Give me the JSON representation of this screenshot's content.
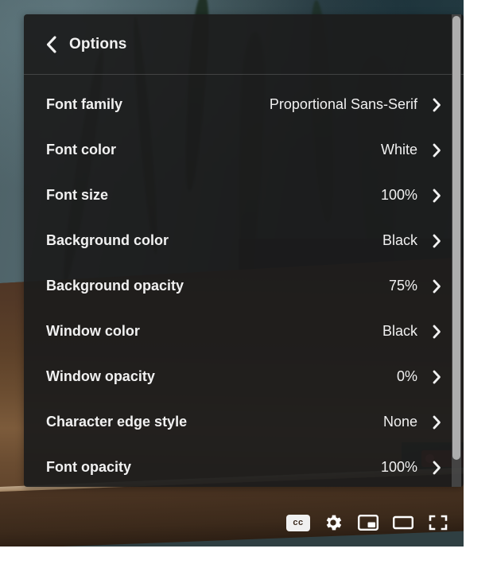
{
  "panel": {
    "title": "Options",
    "back_icon": "chevron-left-icon",
    "rows": [
      {
        "label": "Font family",
        "value": "Proportional Sans-Serif",
        "chevron": "chevron-right-icon"
      },
      {
        "label": "Font color",
        "value": "White",
        "chevron": "chevron-right-icon"
      },
      {
        "label": "Font size",
        "value": "100%",
        "chevron": "chevron-right-icon"
      },
      {
        "label": "Background color",
        "value": "Black",
        "chevron": "chevron-right-icon"
      },
      {
        "label": "Background opacity",
        "value": "75%",
        "chevron": "chevron-right-icon"
      },
      {
        "label": "Window color",
        "value": "Black",
        "chevron": "chevron-right-icon"
      },
      {
        "label": "Window opacity",
        "value": "0%",
        "chevron": "chevron-right-icon"
      },
      {
        "label": "Character edge style",
        "value": "None",
        "chevron": "chevron-right-icon"
      },
      {
        "label": "Font opacity",
        "value": "100%",
        "chevron": "chevron-right-icon"
      }
    ],
    "scrollbar": {
      "name": "panel-scrollbar"
    }
  },
  "controls": [
    {
      "name": "subtitles-cc-button",
      "icon": "cc-icon",
      "label": "cc"
    },
    {
      "name": "settings-button",
      "icon": "gear-icon",
      "label": ""
    },
    {
      "name": "miniplayer-button",
      "icon": "picture-in-picture-icon",
      "label": ""
    },
    {
      "name": "theater-mode-button",
      "icon": "theater-mode-icon",
      "label": ""
    },
    {
      "name": "fullscreen-button",
      "icon": "fullscreen-icon",
      "label": ""
    }
  ],
  "colors": {
    "panel_background": "#1c1c1c",
    "text": "#f1f1f1",
    "scrollbar_thumb": "#adadad",
    "scrollbar_track": "#505050"
  }
}
